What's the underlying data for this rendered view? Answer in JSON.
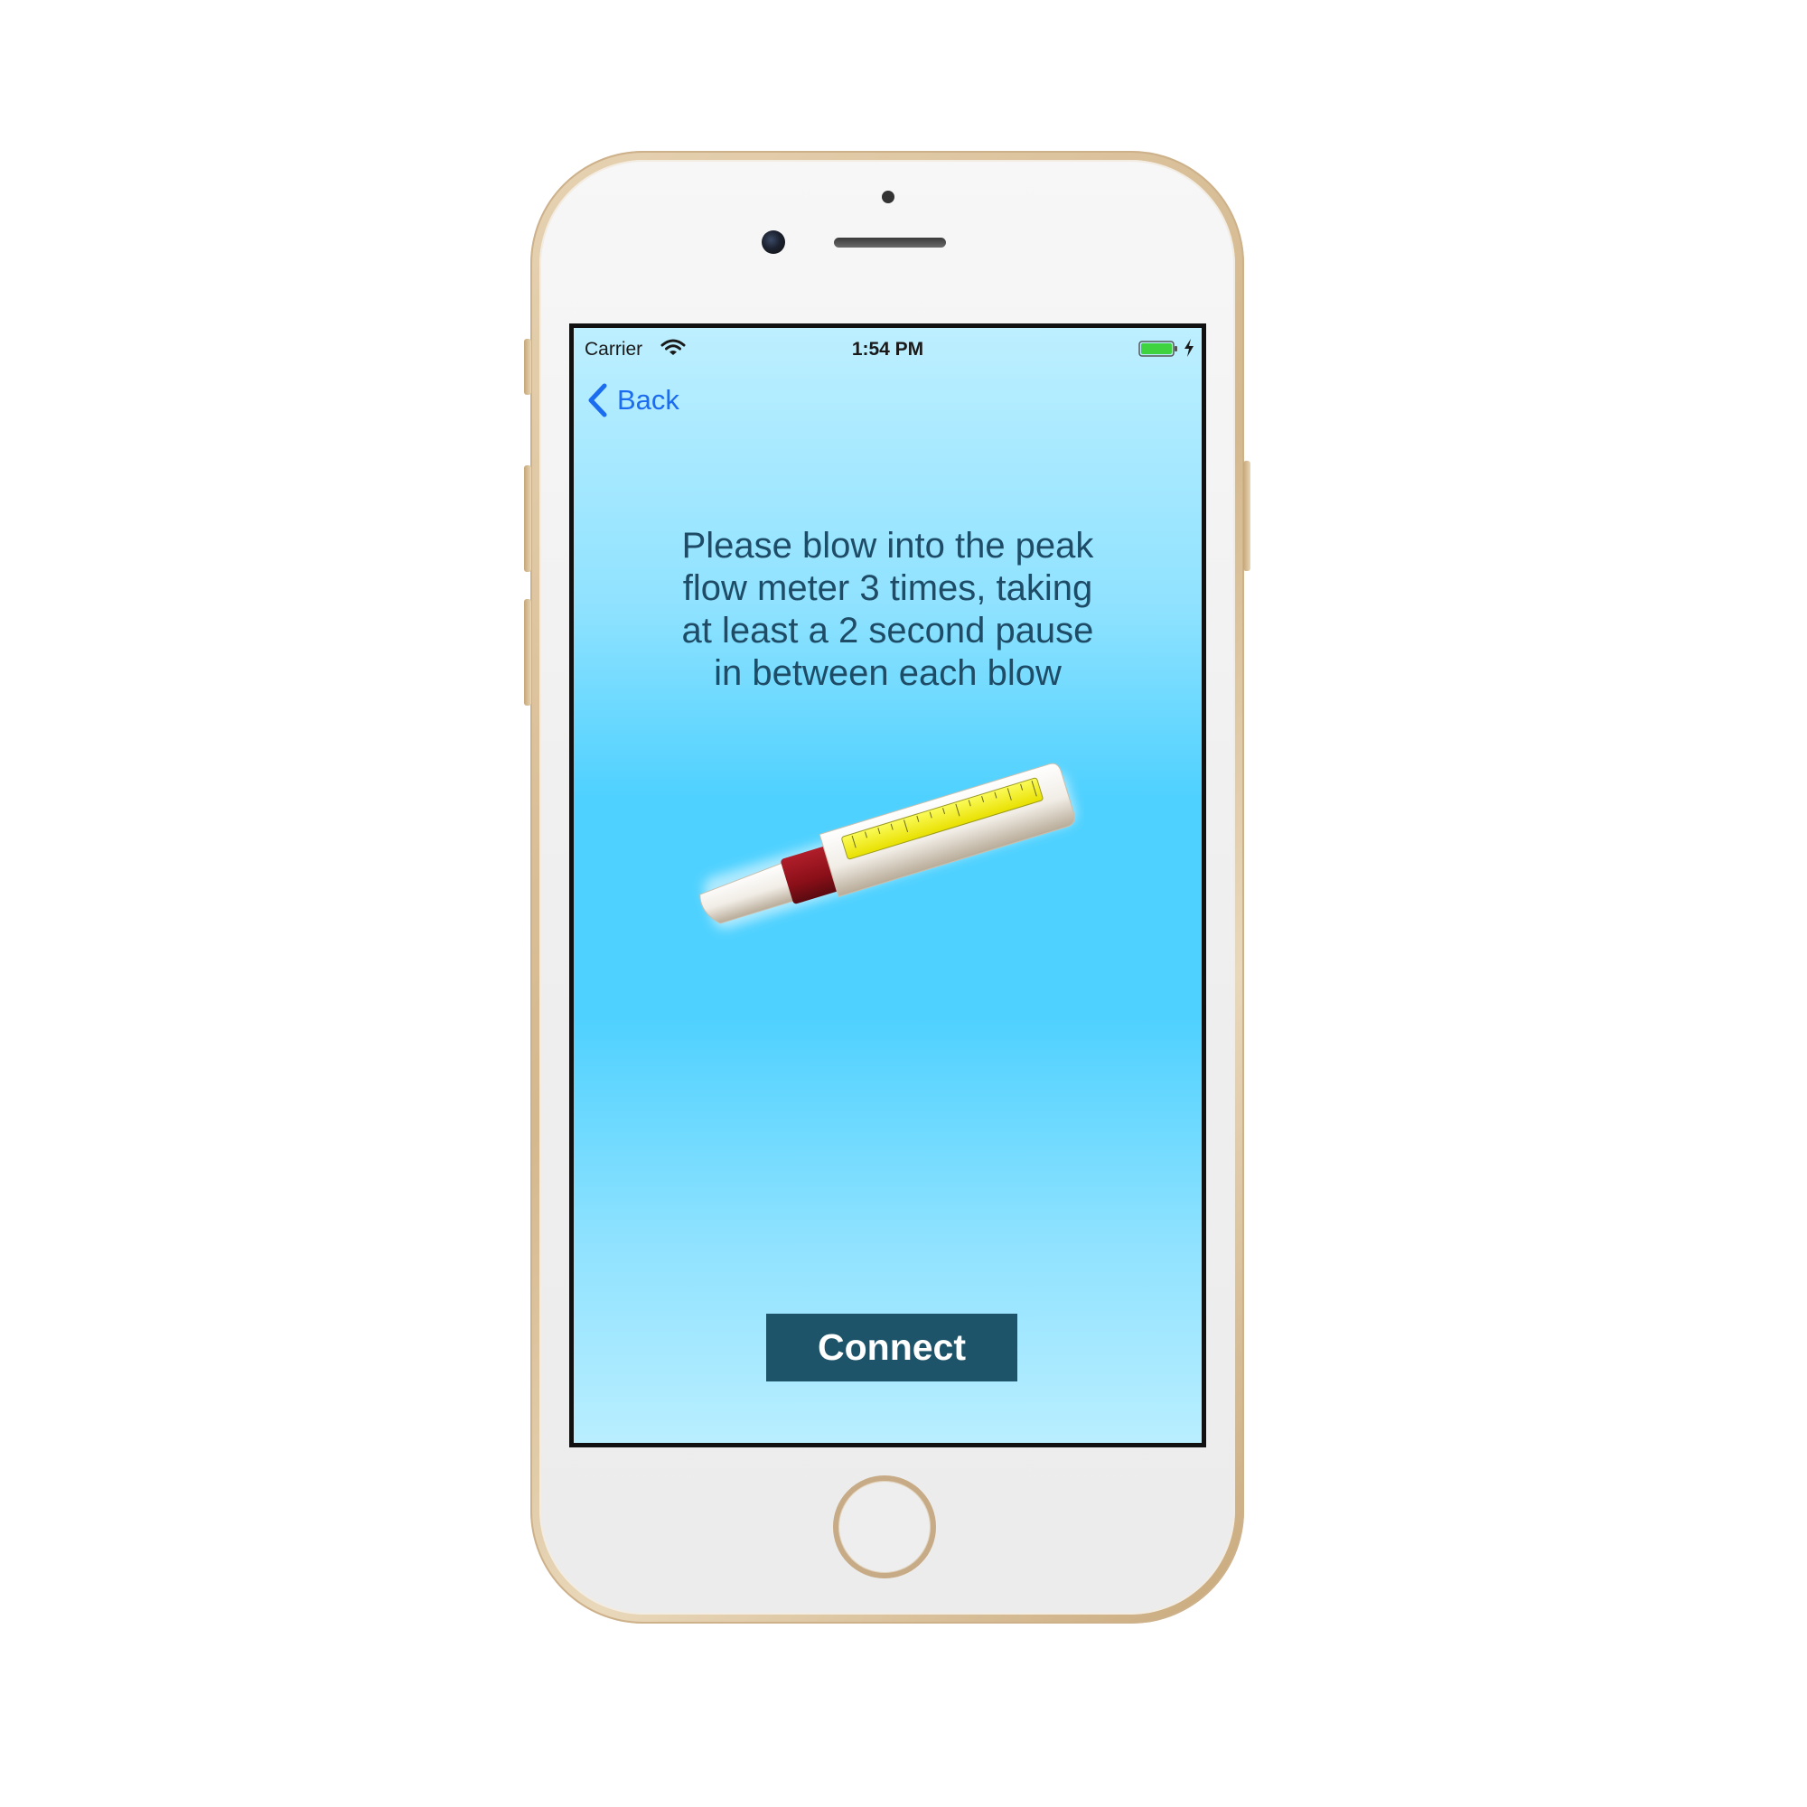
{
  "status_bar": {
    "carrier": "Carrier",
    "time": "1:54 PM",
    "battery_color": "#3fd33f"
  },
  "nav": {
    "back_label": "Back",
    "accent_color": "#1c6cf0"
  },
  "content": {
    "instructions_lines": [
      "Please blow into the peak",
      "flow meter 3 times, taking",
      "at least a 2 second pause",
      "in between each blow"
    ],
    "illustration_icon": "peak-flow-meter-icon"
  },
  "actions": {
    "connect_label": "Connect",
    "connect_color": "#1e5469"
  }
}
